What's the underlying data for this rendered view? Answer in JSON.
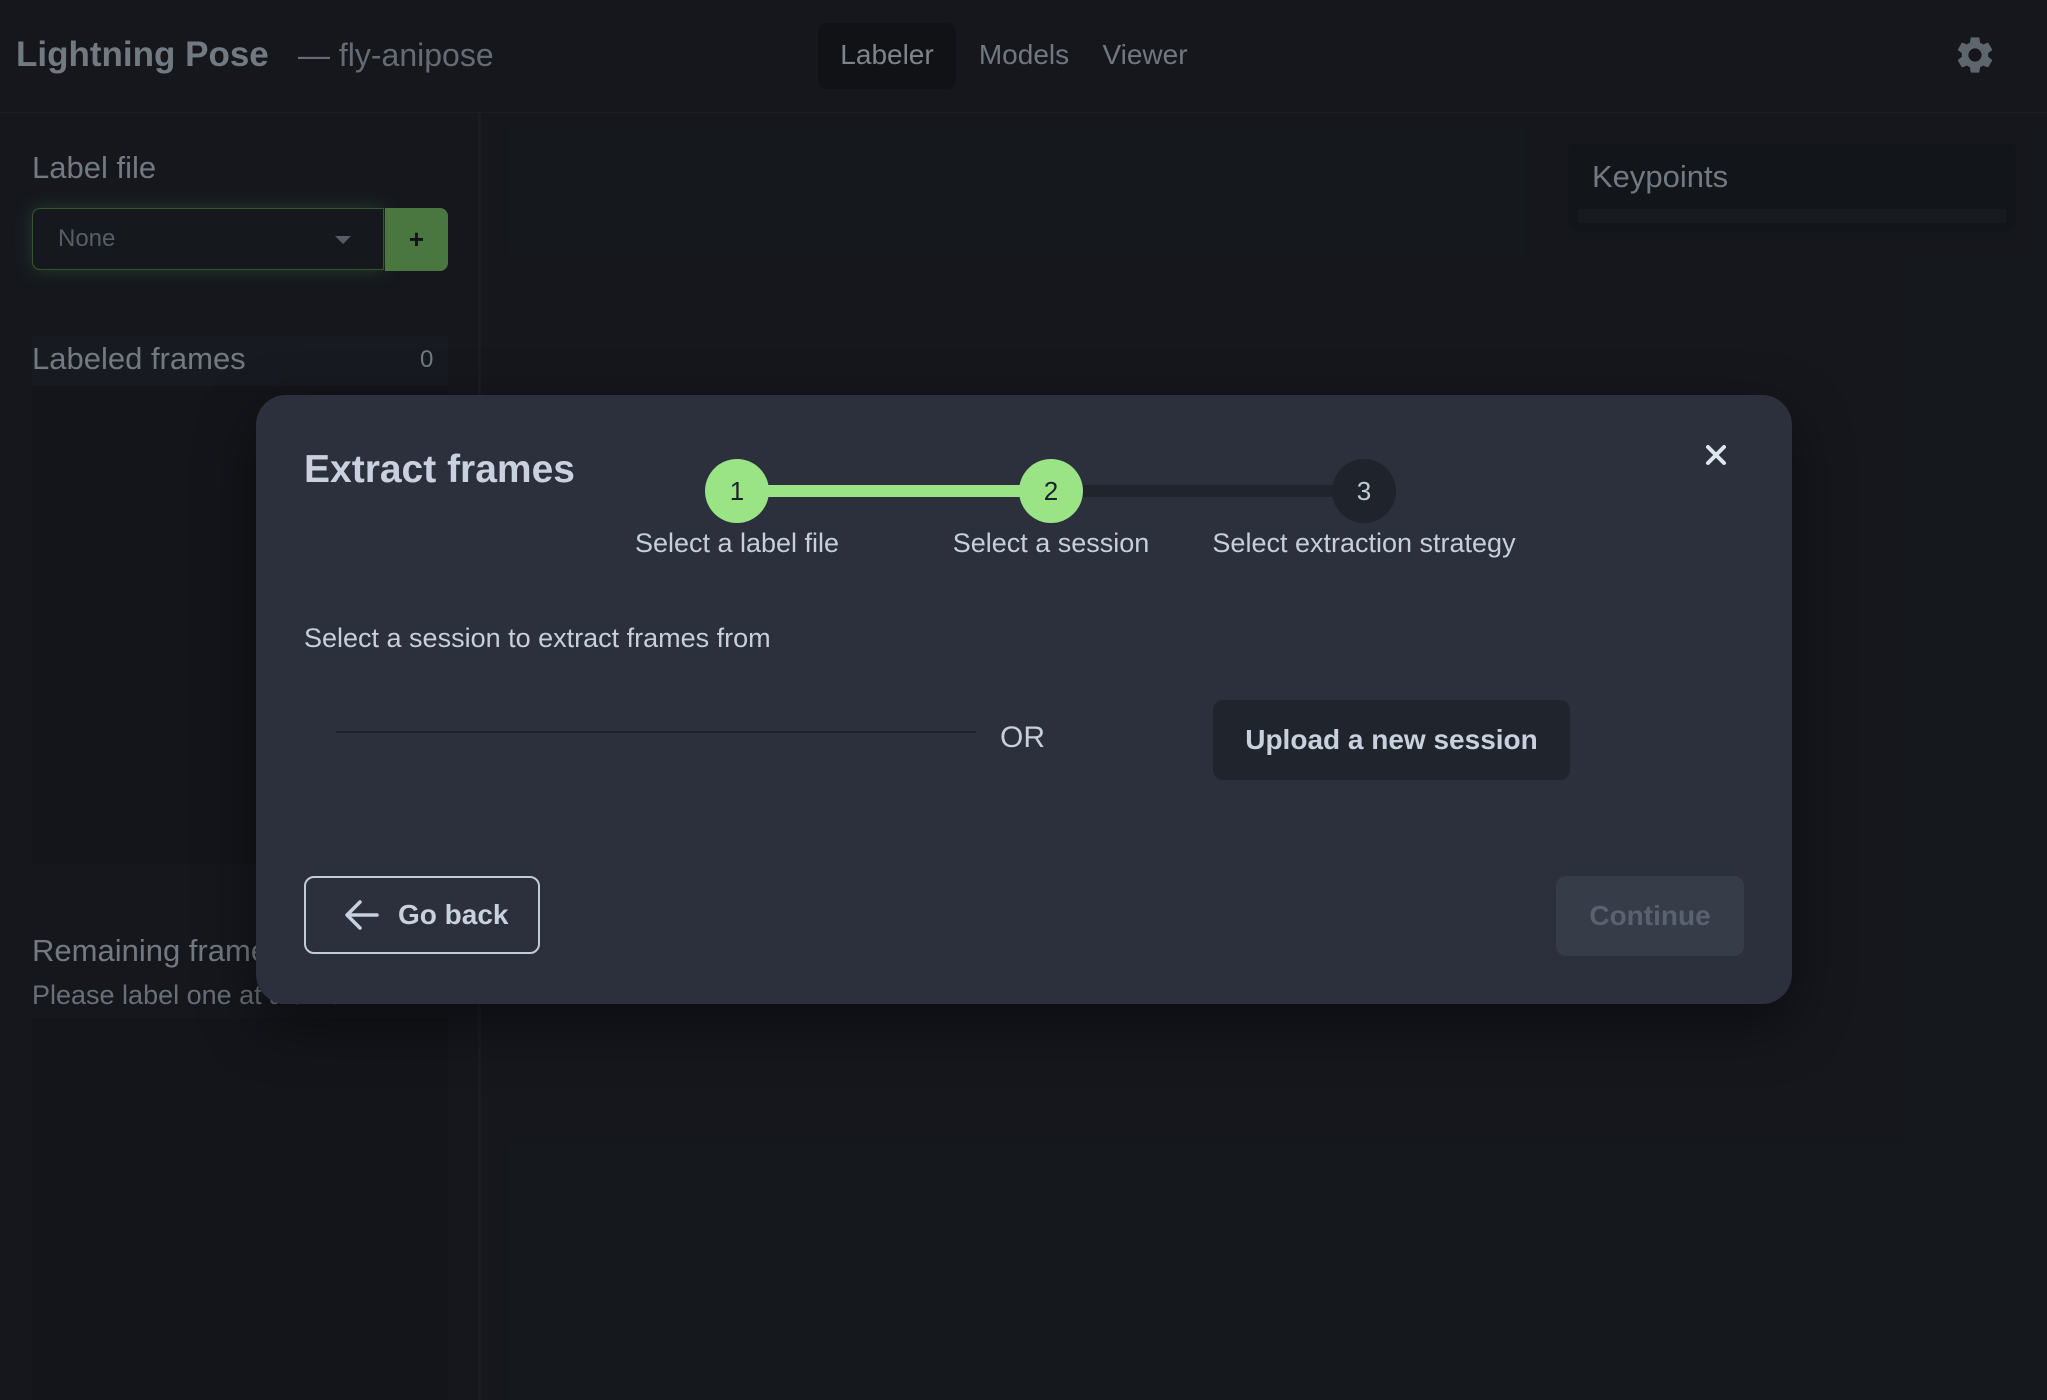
{
  "header": {
    "app_title": "Lightning Pose",
    "project_subtitle": "— fly-anipose",
    "tabs": [
      {
        "label": "Labeler",
        "active": true
      },
      {
        "label": "Models",
        "active": false
      },
      {
        "label": "Viewer",
        "active": false
      }
    ],
    "settings_icon": "gear-icon"
  },
  "sidebar": {
    "label_file_heading": "Label file",
    "label_file_value": "None",
    "add_button_label": "+",
    "labeled_frames_heading": "Labeled frames",
    "labeled_frames_count": "0",
    "remaining_frames_heading": "Remaining frames",
    "remaining_frames_hint": "Please label one at a time"
  },
  "keypoints_panel": {
    "title": "Keypoints"
  },
  "modal": {
    "title": "Extract frames",
    "close_icon": "close-icon",
    "steps": [
      {
        "number": "1",
        "label": "Select a label file",
        "state": "complete"
      },
      {
        "number": "2",
        "label": "Select a session",
        "state": "current"
      },
      {
        "number": "3",
        "label": "Select extraction strategy",
        "state": "pending"
      }
    ],
    "instruction": "Select a session to extract frames from",
    "or_text": "OR",
    "upload_button_label": "Upload a new session",
    "back_button_label": "Go back",
    "continue_button_label": "Continue"
  },
  "colors": {
    "accent_green": "#9be486",
    "modal_background": "#2b303c",
    "app_background": "#1a1d24"
  }
}
